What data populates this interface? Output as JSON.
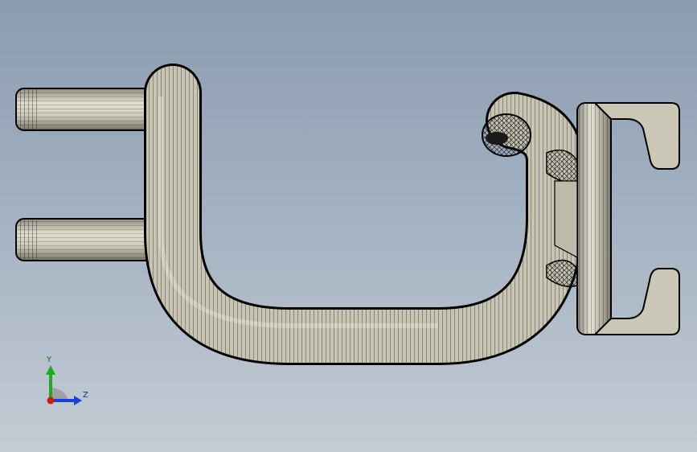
{
  "viewport": {
    "background_top": "#8b9cb0",
    "background_bottom": "#c4ccd5"
  },
  "model": {
    "fill": "#c9c6b6",
    "wire": "#161616",
    "edge": "#000000"
  },
  "triad": {
    "y_label": "Y",
    "z_label": "Z",
    "y_color": "#1faa1f",
    "z_color": "#1c3fd8",
    "x_color": "#d01818"
  }
}
